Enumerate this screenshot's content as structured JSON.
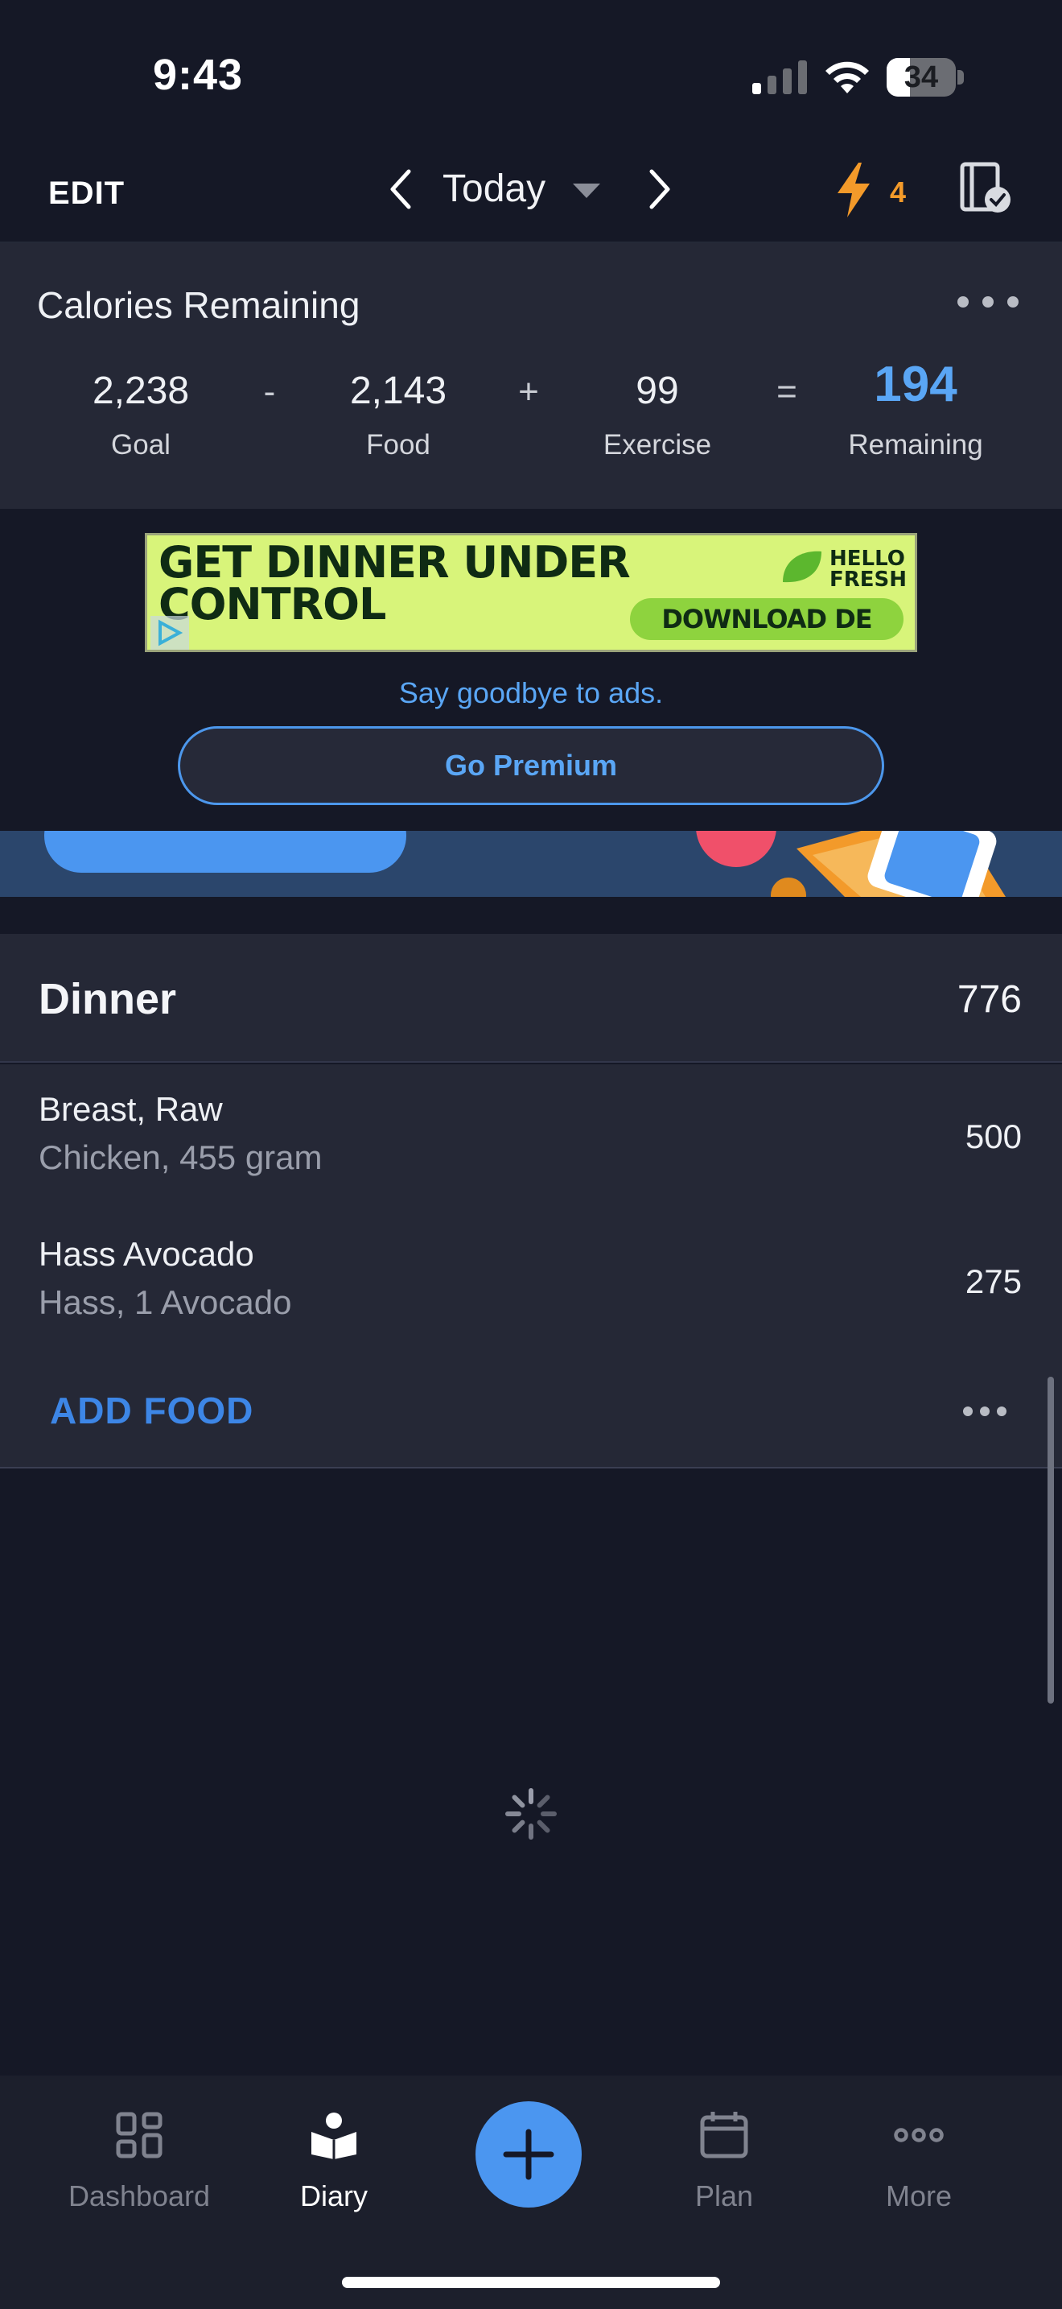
{
  "status_bar": {
    "time": "9:43",
    "battery": "34",
    "battery_level": 0.34
  },
  "header": {
    "edit_label": "EDIT",
    "date_label": "Today",
    "streak_count": "4"
  },
  "calories": {
    "title": "Calories Remaining",
    "goal_value": "2,238",
    "goal_label": "Goal",
    "minus": "-",
    "food_value": "2,143",
    "food_label": "Food",
    "plus": "+",
    "exercise_value": "99",
    "exercise_label": "Exercise",
    "equals": "=",
    "remaining_value": "194",
    "remaining_label": "Remaining"
  },
  "ad": {
    "headline_line1": "GET DINNER UNDER",
    "headline_line2": "CONTROL",
    "brand_line1": "HELLO",
    "brand_line2": "FRESH",
    "cta": "DOWNLOAD DE APP",
    "goodbye_text": "Say goodbye to ads.",
    "premium_button": "Go Premium"
  },
  "dinner": {
    "title": "Dinner",
    "total_calories": "776",
    "items": [
      {
        "name": "Breast, Raw",
        "description": "Chicken, 455 gram",
        "calories": "500"
      },
      {
        "name": "Hass Avocado",
        "description": "Hass, 1 Avocado",
        "calories": "275"
      }
    ],
    "add_food_label": "ADD FOOD"
  },
  "tabbar": {
    "tabs": [
      {
        "label": "Dashboard",
        "icon": "dashboard-icon",
        "active": false
      },
      {
        "label": "Diary",
        "icon": "diary-icon",
        "active": true
      },
      {
        "label": "Plan",
        "icon": "calendar-icon",
        "active": false
      },
      {
        "label": "More",
        "icon": "more-icon",
        "active": false
      }
    ]
  },
  "colors": {
    "background": "#151826",
    "card": "#252836",
    "accent_blue": "#5aa6f5",
    "streak_orange": "#f39a2a",
    "ad_green": "#d8f47a"
  }
}
